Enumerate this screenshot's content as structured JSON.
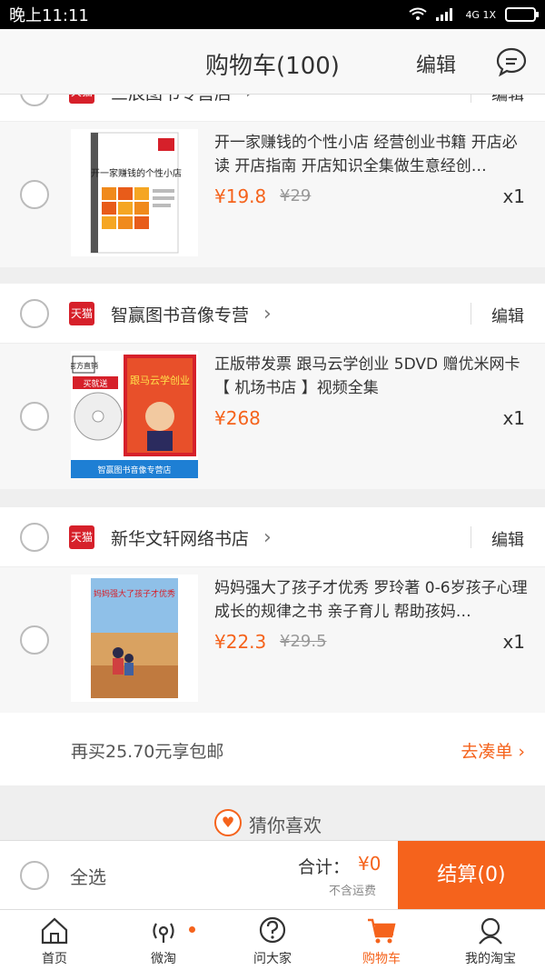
{
  "status_bar": {
    "time": "晚上11:11",
    "network": "4G 1X"
  },
  "header": {
    "title": "购物车(100)",
    "edit_label": "编辑"
  },
  "partial_shop": {
    "name": "三辰图书专营店",
    "edit_label": "编辑",
    "badge": "天猫"
  },
  "shops": [
    {
      "badge": "天猫",
      "name": "智赢图书音像专营",
      "edit_label": "编辑"
    },
    {
      "badge": "天猫",
      "name": "新华文轩网络书店",
      "edit_label": "编辑"
    }
  ],
  "items": [
    {
      "title": "开一家赚钱的个性小店 经营创业书籍 开店必读 开店指南 开店知识全集做生意经创…",
      "price": "¥19.8",
      "original_price": "¥29",
      "qty": "x1",
      "cover": {
        "title": "开一家赚钱的个性小店",
        "bg": "#ffffff",
        "accent": "#f08a1c"
      }
    },
    {
      "title": "正版带发票 跟马云学创业 5DVD 赠优米网卡【 机场书店 】视频全集",
      "price": "¥268",
      "original_price": "",
      "qty": "x1",
      "cover": {
        "title": "跟马云学创业",
        "badge1": "官方直销",
        "badge2": "买就送",
        "footer": "智赢图书音像专营店",
        "bg": "#ffffff",
        "accent": "#d6202a"
      }
    },
    {
      "title": "妈妈强大了孩子才优秀 罗玲著 0-6岁孩子心理成长的规律之书 亲子育儿 帮助孩妈…",
      "price": "¥22.3",
      "original_price": "¥29.5",
      "qty": "x1",
      "cover": {
        "title": "妈妈强大了孩子才优秀",
        "bg": "#6fa8d8",
        "accent": "#d9a261"
      }
    }
  ],
  "promo": {
    "text": "再买25.70元享包邮",
    "link": "去凑单 ›"
  },
  "guess": {
    "icon": "heart-icon",
    "label": "猜你喜欢"
  },
  "checkout": {
    "select_all": "全选",
    "total_label": "合计：",
    "total_value": "¥0",
    "shipping_note": "不含运费",
    "pay_label": "结算(0)"
  },
  "tabs": [
    {
      "label": "首页",
      "icon": "home-icon",
      "active": false
    },
    {
      "label": "微淘",
      "icon": "broadcast-icon",
      "active": false
    },
    {
      "label": "问大家",
      "icon": "question-icon",
      "active": false
    },
    {
      "label": "购物车",
      "icon": "cart-icon",
      "active": true
    },
    {
      "label": "我的淘宝",
      "icon": "profile-icon",
      "active": false
    }
  ],
  "colors": {
    "accent": "#f5631c",
    "tmall_red": "#d6202a"
  }
}
